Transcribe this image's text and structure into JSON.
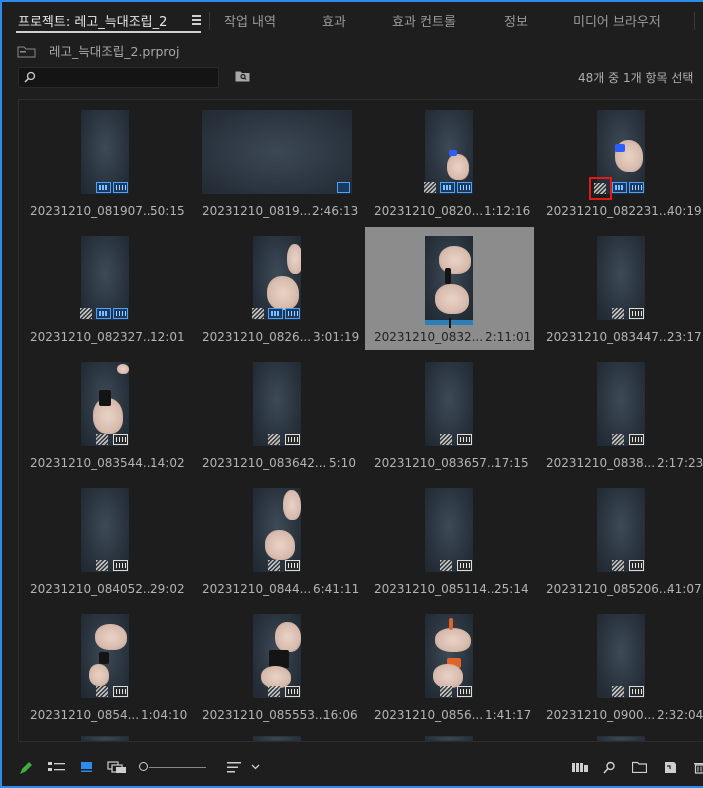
{
  "tabs": [
    {
      "label": "프로젝트: 레고_늑대조립_2",
      "active": true
    },
    {
      "label": "작업 내역"
    },
    {
      "label": "효과"
    },
    {
      "label": "효과 컨트롤"
    },
    {
      "label": "정보"
    },
    {
      "label": "미디어 브라우저"
    }
  ],
  "project": {
    "file_name": "레고_늑대조립_2.prproj"
  },
  "search": {
    "value": "",
    "placeholder": ""
  },
  "status": {
    "selection_count": "48개 중 1개 항목 선택"
  },
  "colors": {
    "accent": "#2d8ceb",
    "selected_bg": "#8c8c8c",
    "highlight": "#e01a1a",
    "badge_blue": "#4aa3ff"
  },
  "clips": [
    {
      "name": "20231210_081907...",
      "duration": "50:15",
      "badges": [
        "vid",
        "aud"
      ]
    },
    {
      "name": "20231210_0819...",
      "duration": "2:46:13",
      "badges": [
        "seq"
      ]
    },
    {
      "name": "20231210_0820...",
      "duration": "1:12:16",
      "badges": [
        "fx",
        "vid",
        "aud"
      ]
    },
    {
      "name": "20231210_082231...",
      "duration": "40:19",
      "badges": [
        "fx",
        "vid",
        "aud"
      ],
      "highlight": true
    },
    {
      "name": "20231210_082327...",
      "duration": "12:01",
      "badges": [
        "fx",
        "vid",
        "aud"
      ]
    },
    {
      "name": "20231210_0826...",
      "duration": "3:01:19",
      "badges": [
        "fx",
        "vid",
        "aud"
      ]
    },
    {
      "name": "20231210_0832...",
      "duration": "2:11:01",
      "badges": [],
      "selected": true
    },
    {
      "name": "20231210_083447...",
      "duration": "23:17",
      "badges": [
        "audw"
      ]
    },
    {
      "name": "20231210_083544...",
      "duration": "14:02",
      "badges": [
        "fx",
        "audw"
      ]
    },
    {
      "name": "20231210_083642...",
      "duration": "5:10",
      "badges": [
        "fx",
        "audw"
      ]
    },
    {
      "name": "20231210_083657...",
      "duration": "17:15",
      "badges": [
        "fx",
        "audw"
      ]
    },
    {
      "name": "20231210_0838...",
      "duration": "2:17:23",
      "badges": [
        "fx",
        "audw"
      ]
    },
    {
      "name": "20231210_084052...",
      "duration": "29:02",
      "badges": [
        "fx",
        "audw"
      ]
    },
    {
      "name": "20231210_0844...",
      "duration": "6:41:11",
      "badges": [
        "fx",
        "audw"
      ]
    },
    {
      "name": "20231210_085114...",
      "duration": "25:14",
      "badges": [
        "fx",
        "audw"
      ]
    },
    {
      "name": "20231210_085206...",
      "duration": "41:07",
      "badges": [
        "fx",
        "audw"
      ]
    },
    {
      "name": "20231210_0854...",
      "duration": "1:04:10",
      "badges": [
        "fx",
        "audw"
      ]
    },
    {
      "name": "20231210_085553...",
      "duration": "16:06",
      "badges": [
        "fx",
        "audw"
      ]
    },
    {
      "name": "20231210_0856...",
      "duration": "1:41:17",
      "badges": [
        "fx",
        "audw"
      ]
    },
    {
      "name": "20231210_0900...",
      "duration": "2:32:04",
      "badges": [
        "fx",
        "audw"
      ]
    }
  ],
  "toolbar_icons": [
    "pencil-icon",
    "list-view-icon",
    "icon-view-icon",
    "freeform-view-icon",
    "zoom-slider",
    "sort-icon",
    "chevron-down-icon",
    "automate-to-sequence-icon",
    "find-icon",
    "new-bin-icon",
    "new-item-icon",
    "clear-icon"
  ]
}
